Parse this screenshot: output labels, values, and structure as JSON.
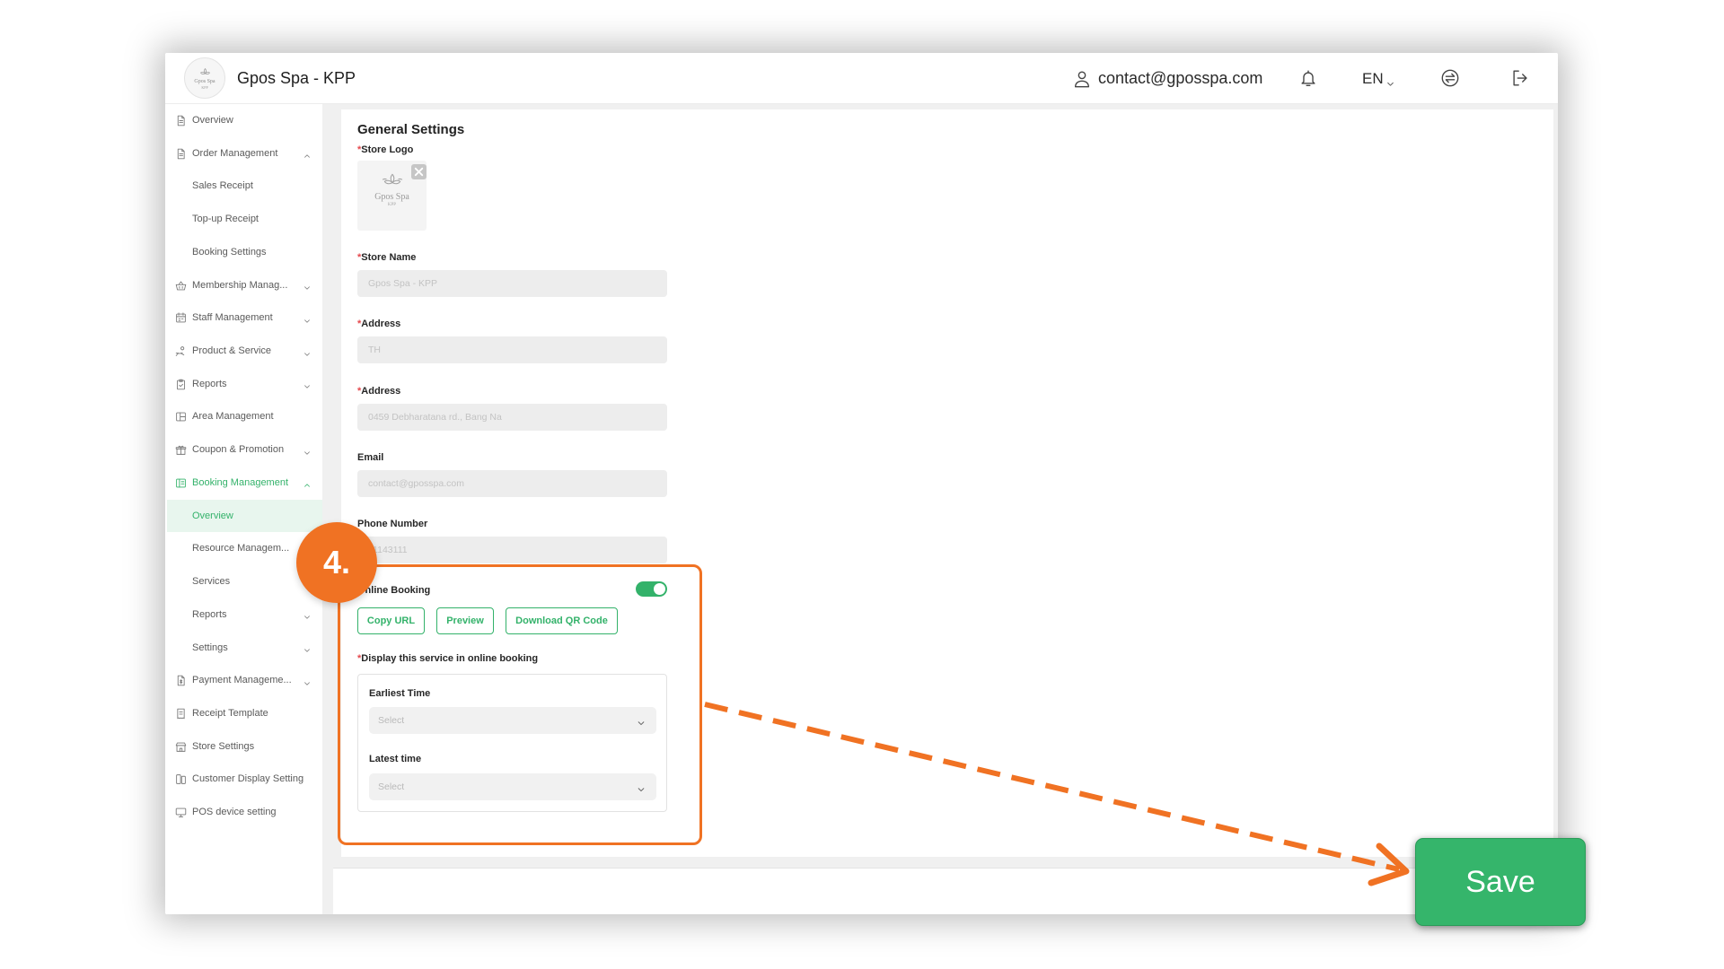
{
  "colors": {
    "accent": "#33b26a",
    "accent_light": "#e8f6ee",
    "annotation": "#f07223",
    "required": "#e5484d",
    "save_button": "#35b56b"
  },
  "header": {
    "logo_text": "Gpos Spa",
    "logo_subtext": "KPP",
    "title": "Gpos Spa - KPP",
    "user_icon": "user-icon",
    "user_email": "contact@gposspa.com",
    "notification_icon": "bell-icon",
    "language": "EN",
    "switch_icon": "switch-icon",
    "logout_icon": "logout-icon"
  },
  "sidebar": {
    "items": [
      {
        "label": "Overview",
        "icon": "file-icon",
        "level": 0,
        "chevron": "none"
      },
      {
        "label": "Order Management",
        "icon": "file-icon",
        "level": 0,
        "chevron": "up"
      },
      {
        "label": "Sales Receipt",
        "level": 1,
        "chevron": "none"
      },
      {
        "label": "Top-up Receipt",
        "level": 1,
        "chevron": "none"
      },
      {
        "label": "Booking Settings",
        "level": 1,
        "chevron": "none"
      },
      {
        "label": "Membership Manag...",
        "icon": "basket-icon",
        "level": 0,
        "chevron": "down"
      },
      {
        "label": "Staff Management",
        "icon": "staff-icon",
        "level": 0,
        "chevron": "down"
      },
      {
        "label": "Product & Service",
        "icon": "product-icon",
        "level": 0,
        "chevron": "down"
      },
      {
        "label": "Reports",
        "icon": "report-icon",
        "level": 0,
        "chevron": "down"
      },
      {
        "label": "Area Management",
        "icon": "area-icon",
        "level": 0,
        "chevron": "none"
      },
      {
        "label": "Coupon & Promotion",
        "icon": "gift-icon",
        "level": 0,
        "chevron": "down"
      },
      {
        "label": "Booking Management",
        "icon": "booking-icon",
        "level": 0,
        "chevron": "up",
        "selected": true
      },
      {
        "label": "Overview",
        "level": 1,
        "chevron": "none",
        "active": true
      },
      {
        "label": "Resource Managem...",
        "level": 1,
        "chevron": "none"
      },
      {
        "label": "Services",
        "level": 1,
        "chevron": "none"
      },
      {
        "label": "Reports",
        "level": 1,
        "chevron": "down"
      },
      {
        "label": "Settings",
        "level": 1,
        "chevron": "down"
      },
      {
        "label": "Payment Manageme...",
        "icon": "payment-icon",
        "level": 0,
        "chevron": "down"
      },
      {
        "label": "Receipt Template",
        "icon": "receipt-icon",
        "level": 0,
        "chevron": "none"
      },
      {
        "label": "Store Settings",
        "icon": "store-icon",
        "level": 0,
        "chevron": "none"
      },
      {
        "label": "Customer Display Setting",
        "icon": "display-icon",
        "level": 0,
        "chevron": "none"
      },
      {
        "label": "POS device setting",
        "icon": "pos-icon",
        "level": 0,
        "chevron": "none"
      }
    ]
  },
  "form": {
    "title": "General Settings",
    "required_mark": "*",
    "store_logo": {
      "label": "Store Logo",
      "required": true,
      "remove_icon": "close-icon"
    },
    "fields": [
      {
        "label": "Store Name",
        "required": true,
        "value": "Gpos Spa - KPP"
      },
      {
        "label": "Address",
        "required": true,
        "value": "TH"
      },
      {
        "label": "Address",
        "required": true,
        "value": "0459 Debharatana rd., Bang Na"
      },
      {
        "label": "Email",
        "required": false,
        "value": "contact@gposspa.com"
      },
      {
        "label": "Phone Number",
        "required": false,
        "value": "11143111"
      }
    ],
    "online_booking": {
      "label": "Online Booking",
      "enabled": true,
      "buttons": [
        "Copy URL",
        "Preview",
        "Download QR Code"
      ],
      "display_label": "Display this service in online booking",
      "display_required": true,
      "earliest_time": {
        "label": "Earliest Time",
        "placeholder": "Select"
      },
      "latest_time": {
        "label": "Latest time",
        "placeholder": "Select"
      }
    }
  },
  "annotation": {
    "step": "4.",
    "save_label": "Save"
  }
}
